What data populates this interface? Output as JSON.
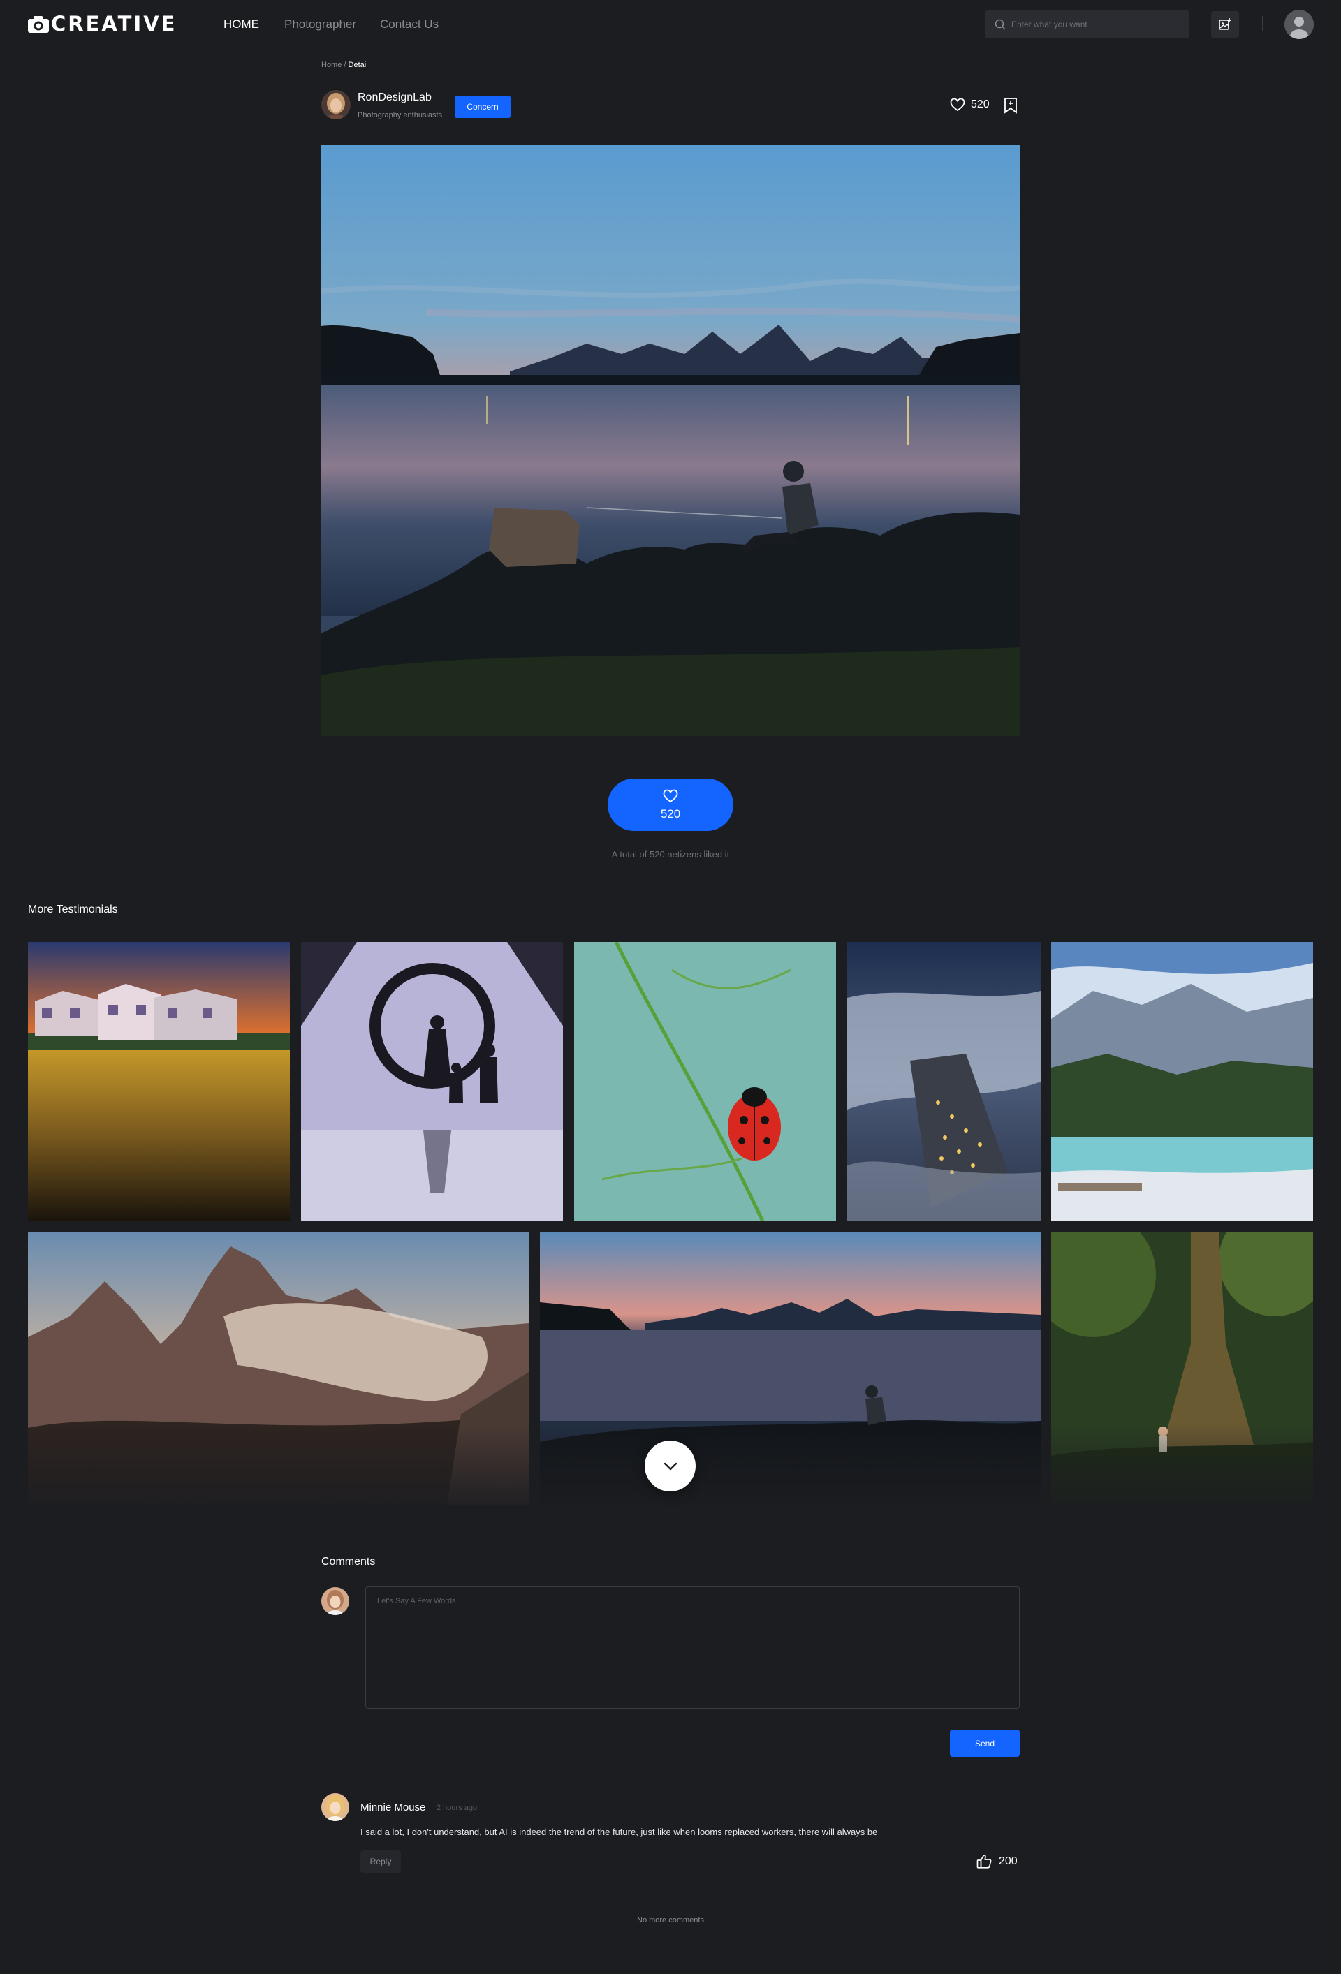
{
  "navbar": {
    "logo_text": "CREATIVE",
    "links": [
      {
        "label": "HOME",
        "active": true
      },
      {
        "label": "Photographer",
        "active": false
      },
      {
        "label": "Contact Us",
        "active": false
      }
    ],
    "search_placeholder": "Enter what you want",
    "icons": [
      "camera-logo-icon",
      "search-icon",
      "image-upload-icon",
      "user-avatar-icon"
    ]
  },
  "breadcrumb": {
    "home": "Home",
    "separator": " / ",
    "current": "Detail"
  },
  "author": {
    "name": "RonDesignLab",
    "role": "Photography enthusiasts",
    "follow_label": "Concern"
  },
  "post": {
    "likes": "520",
    "main_photo": "Sunset lake with silhouetted fisherman on rocks",
    "big_like_count": "520",
    "liked_note": "A total of 520 netizens liked it"
  },
  "testimonials": {
    "title": "More Testimonials",
    "items": [
      {
        "subject": "Houses at sunset above golden wheat field"
      },
      {
        "subject": "Family silhouette in circular art installation"
      },
      {
        "subject": "Ladybug on green grass stem"
      },
      {
        "subject": "Aerial view of village lights under clouds"
      },
      {
        "subject": "Mountain lake with turquoise water"
      },
      {
        "subject": "Dolomite peaks in morning fog"
      },
      {
        "subject": "Sunset lake with fisherman"
      },
      {
        "subject": "Child beside large tree in forest"
      }
    ]
  },
  "comments": {
    "title": "Comments",
    "input_placeholder": "Let's Say A Few Words",
    "send_label": "Send",
    "list": [
      {
        "name": "Minnie Mouse",
        "time": "2 hours ago",
        "text": "I said a lot, I don't understand, but AI is indeed the trend of the future, just like when looms replaced workers, there will always be",
        "reply_label": "Reply",
        "likes": "200"
      }
    ],
    "end_note": "No more comments"
  },
  "colors": {
    "accent": "#1465ff",
    "background": "#1c1d21",
    "input_bg": "#2a2c31"
  }
}
